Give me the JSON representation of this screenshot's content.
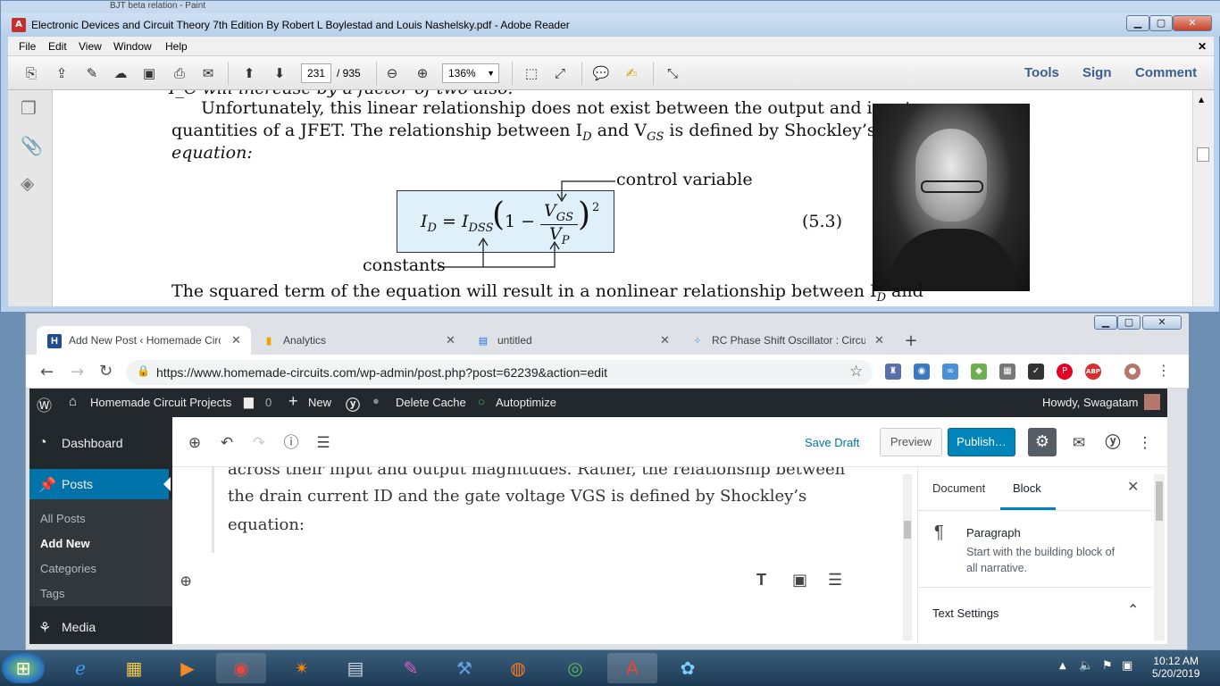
{
  "reader": {
    "background_app_title": "BJT beta relation - Paint",
    "title": "Electronic Devices and Circuit Theory 7th Edition By Robert L Boylestad and Louis Nashelsky.pdf - Adobe Reader",
    "menu": [
      "File",
      "Edit",
      "View",
      "Window",
      "Help"
    ],
    "page_current": "231",
    "page_total": "/ 935",
    "zoom": "136%",
    "links": [
      "Tools",
      "Sign",
      "Comment"
    ],
    "doc": {
      "top_cut": "I_C will increase by a factor of two also.",
      "p1_l1": "Unfortunately, this linear relationship does not exist between the output and input",
      "p1_l2": "quantities of a JFET. The relationship between I",
      "p1_l2_sub": "D",
      "p1_l2_mid": " and V",
      "p1_l2_sub2": "GS",
      "p1_l2_end": " is defined by Shockley’s",
      "p1_l3": "equation:",
      "label_control": "control variable",
      "label_constants": "constants",
      "eq_number": "(5.3)",
      "eq_lhs": "I",
      "eq_lhs_sub": "D",
      "eq_eq": "=",
      "eq_idss": "I",
      "eq_idss_sub": "DSS",
      "eq_one": "1 −",
      "eq_num": "V",
      "eq_num_sub": "GS",
      "eq_den": "V",
      "eq_den_sub": "P",
      "eq_exp": "2",
      "p2": "The squared term of the equation will result in a nonlinear relationship between I",
      "p2_sub": "D",
      "p2_end": " and"
    }
  },
  "chrome": {
    "tabs": [
      {
        "label": "Add New Post ‹ Homemade Circu",
        "icon": "H"
      },
      {
        "label": "Analytics",
        "icon": "analytics-icon"
      },
      {
        "label": "untitled",
        "icon": "sheet-icon"
      },
      {
        "label": "RC Phase Shift Oscillator : Circuit",
        "icon": "bulb-icon"
      }
    ],
    "url": "https://www.homemade-circuits.com/wp-admin/post.php?post=62239&action=edit"
  },
  "wp": {
    "site": "Homemade Circuit Projects",
    "comments": "0",
    "new": "New",
    "delete_cache": "Delete Cache",
    "autoptimize": "Autoptimize",
    "howdy": "Howdy, Swagatam",
    "sidebar": {
      "dashboard": "Dashboard",
      "posts": "Posts",
      "sub": [
        "All Posts",
        "Add New",
        "Categories",
        "Tags"
      ],
      "media": "Media"
    },
    "toolbar": {
      "save_draft": "Save Draft",
      "preview": "Preview",
      "publish": "Publish…"
    },
    "content": [
      "across their input and output magnitudes. Rather, the relationship between",
      "the drain current ID and the gate voltage VGS is defined by Shockley’s",
      "equation:"
    ],
    "panel": {
      "tab_document": "Document",
      "tab_block": "Block",
      "block_name": "Paragraph",
      "block_desc_1": "Start with the building block of",
      "block_desc_2": "all narrative.",
      "text_settings": "Text Settings"
    }
  },
  "taskbar": {
    "time": "10:12 AM",
    "date": "5/20/2019"
  },
  "colors": {
    "wp_blue": "#0085ba",
    "wp_dark": "#23282d",
    "reader_link": "#3a5f8f",
    "eq_box": "#dff0fb"
  }
}
